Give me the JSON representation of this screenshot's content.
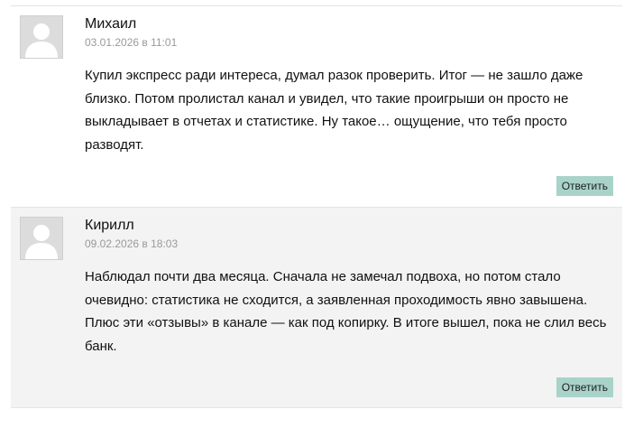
{
  "comments": [
    {
      "author": "Михаил",
      "date": "03.01.2026 в 11:01",
      "text": "Купил экспресс ради интереса, думал разок проверить. Итог — не зашло даже близко. Потом пролистал канал и увидел, что такие проигрыши он просто не выкладывает в отчетах и статистике. Ну такое… ощущение, что тебя просто разводят.",
      "reply_label": "Ответить",
      "avatar_icon": "user-placeholder-icon"
    },
    {
      "author": "Кирилл",
      "date": "09.02.2026 в 18:03",
      "text": "Наблюдал почти два месяца. Сначала не замечал подвоха, но потом стало очевидно: статистика не сходится, а заявленная проходимость явно завышена. Плюс эти «отзывы» в канале — как под копирку. В итоге вышел, пока не слил весь банк.",
      "reply_label": "Ответить",
      "avatar_icon": "user-placeholder-icon"
    }
  ],
  "colors": {
    "reply_button_bg": "#a9d3c9",
    "alt_comment_bg": "#f3f3f3",
    "date_text": "#9a9a9a"
  }
}
